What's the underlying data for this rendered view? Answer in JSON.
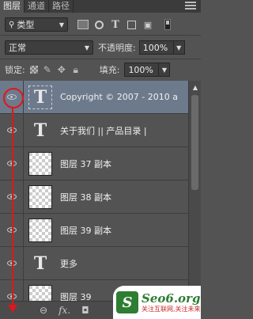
{
  "tabs": [
    {
      "label": "图层",
      "active": true
    },
    {
      "label": "通道",
      "active": false
    },
    {
      "label": "路径",
      "active": false
    }
  ],
  "filter": {
    "kind_label": "类型",
    "icons": [
      "image-filter-icon",
      "adjustment-filter-icon",
      "type-filter-icon",
      "shape-filter-icon",
      "smart-object-filter-icon"
    ]
  },
  "blend": {
    "mode": "正常",
    "opacity_label": "不透明度:",
    "opacity_value": "100%"
  },
  "lock": {
    "label": "锁定:",
    "fill_label": "填充:",
    "fill_value": "100%"
  },
  "layers": [
    {
      "name": "Copyright © 2007 - 2010 a",
      "kind": "text",
      "selected": true
    },
    {
      "name": "关于我们 || 产品目录 |",
      "kind": "text",
      "selected": false
    },
    {
      "name": "图层 37 副本",
      "kind": "raster",
      "selected": false
    },
    {
      "name": "图层 38 副本",
      "kind": "raster",
      "selected": false
    },
    {
      "name": "图层 39 副本",
      "kind": "raster",
      "selected": false
    },
    {
      "name": "更多",
      "kind": "text",
      "selected": false
    },
    {
      "name": "图层 39",
      "kind": "raster",
      "selected": false
    }
  ],
  "bottom_bar": {
    "link_glyph": "⊖",
    "fx_label": "fx.",
    "mask_glyph": "◘"
  },
  "watermark": {
    "logo_letter": "S",
    "domain": "Seo6.org",
    "slogan": "关注互联网,关注未来"
  },
  "colors": {
    "annotation": "#e0161c",
    "selection": "#6d7a8c",
    "panel": "#535353"
  }
}
